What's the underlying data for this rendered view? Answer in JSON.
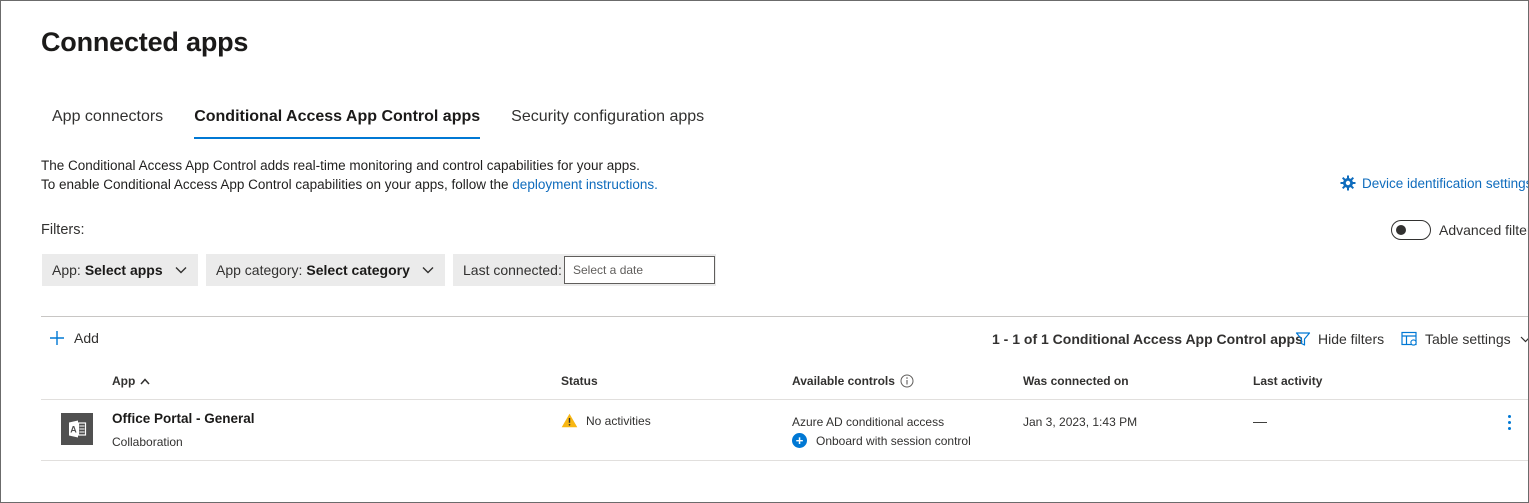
{
  "page": {
    "title": "Connected apps"
  },
  "tabs": [
    {
      "label": "App connectors",
      "active": false
    },
    {
      "label": "Conditional Access App Control apps",
      "active": true
    },
    {
      "label": "Security configuration apps",
      "active": false
    }
  ],
  "description": {
    "line1": "The Conditional Access App Control adds real-time monitoring and control capabilities for your apps.",
    "line2_prefix": "To enable Conditional Access App Control capabilities on your apps, follow the ",
    "line2_link": "deployment instructions."
  },
  "device_identification": {
    "label": "Device identification settings",
    "icon": "gear-icon"
  },
  "filters": {
    "label": "Filters:",
    "advanced_label": "Advanced filters",
    "advanced_enabled": false,
    "app": {
      "prefix": "App:",
      "value": "Select apps"
    },
    "category": {
      "prefix": "App category:",
      "value": "Select category"
    },
    "last_connected": {
      "prefix": "Last connected:",
      "placeholder": "Select a date"
    }
  },
  "toolbar": {
    "add_label": "Add",
    "count_text": "1 - 1 of 1 Conditional Access App Control apps",
    "hide_filters_label": "Hide filters",
    "table_settings_label": "Table settings"
  },
  "table": {
    "columns": {
      "app": "App",
      "status": "Status",
      "available_controls": "Available controls",
      "was_connected_on": "Was connected on",
      "last_activity": "Last activity"
    },
    "sort": {
      "column": "app",
      "direction": "ascending"
    },
    "rows": [
      {
        "app_name": "Office Portal - General",
        "category": "Collaboration",
        "status": "No activities",
        "status_icon": "warning-icon",
        "control_primary": "Azure AD conditional access",
        "control_action": "Onboard with session control",
        "connected_on": "Jan 3, 2023, 1:43 PM",
        "last_activity": "—"
      }
    ]
  },
  "colors": {
    "accent": "#0078d4",
    "link": "#0f6cbd",
    "warning": "#f8b713",
    "filter_bg": "#ebebeb"
  }
}
